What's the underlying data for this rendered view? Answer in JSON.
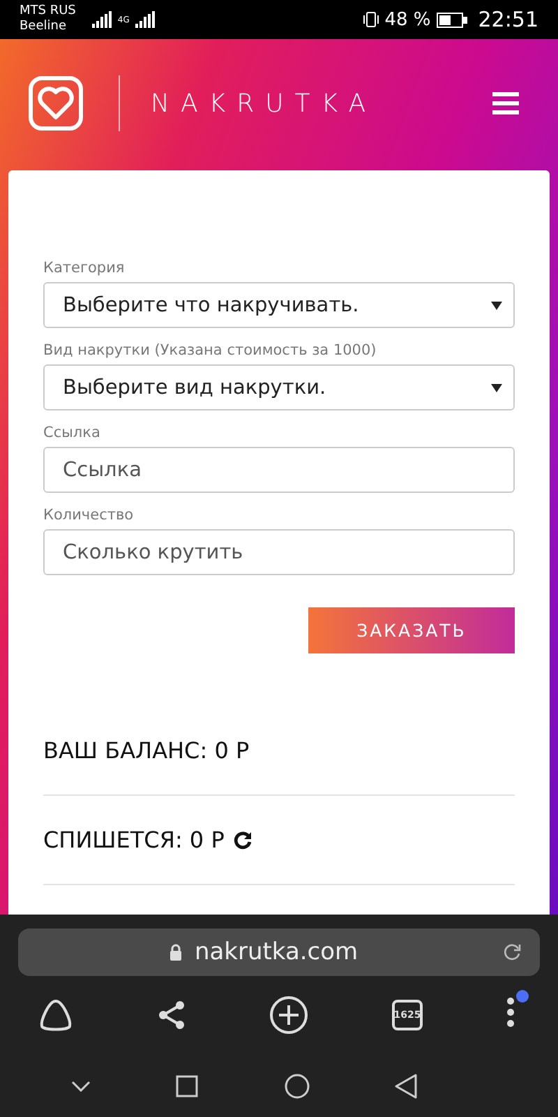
{
  "status_bar": {
    "carrier": "MTS RUS",
    "carrier_2": "Beeline",
    "network": "4G",
    "battery": "48 %",
    "time": "22:51"
  },
  "header": {
    "brand": "NAKRUTKA"
  },
  "form": {
    "fields": [
      {
        "kind": "select",
        "label": "Категория",
        "value": "Выберите что накручивать."
      },
      {
        "kind": "select",
        "label": "Вид накрутки (Указана стоимость за 1000)",
        "value": "Выберите вид накрутки."
      },
      {
        "kind": "input",
        "label": "Ссылка",
        "placeholder": "Ссылка"
      },
      {
        "kind": "input",
        "label": "Количество",
        "placeholder": "Сколько крутить"
      }
    ],
    "submit": "ЗАКАЗАТЬ"
  },
  "balance": "ВАШ БАЛАНС: 0 Р",
  "charge": "СПИШЕТСЯ: 0 Р",
  "browser": {
    "url": "nakrutka.com",
    "tabs_count": "1625",
    "menu_notification": true
  }
}
